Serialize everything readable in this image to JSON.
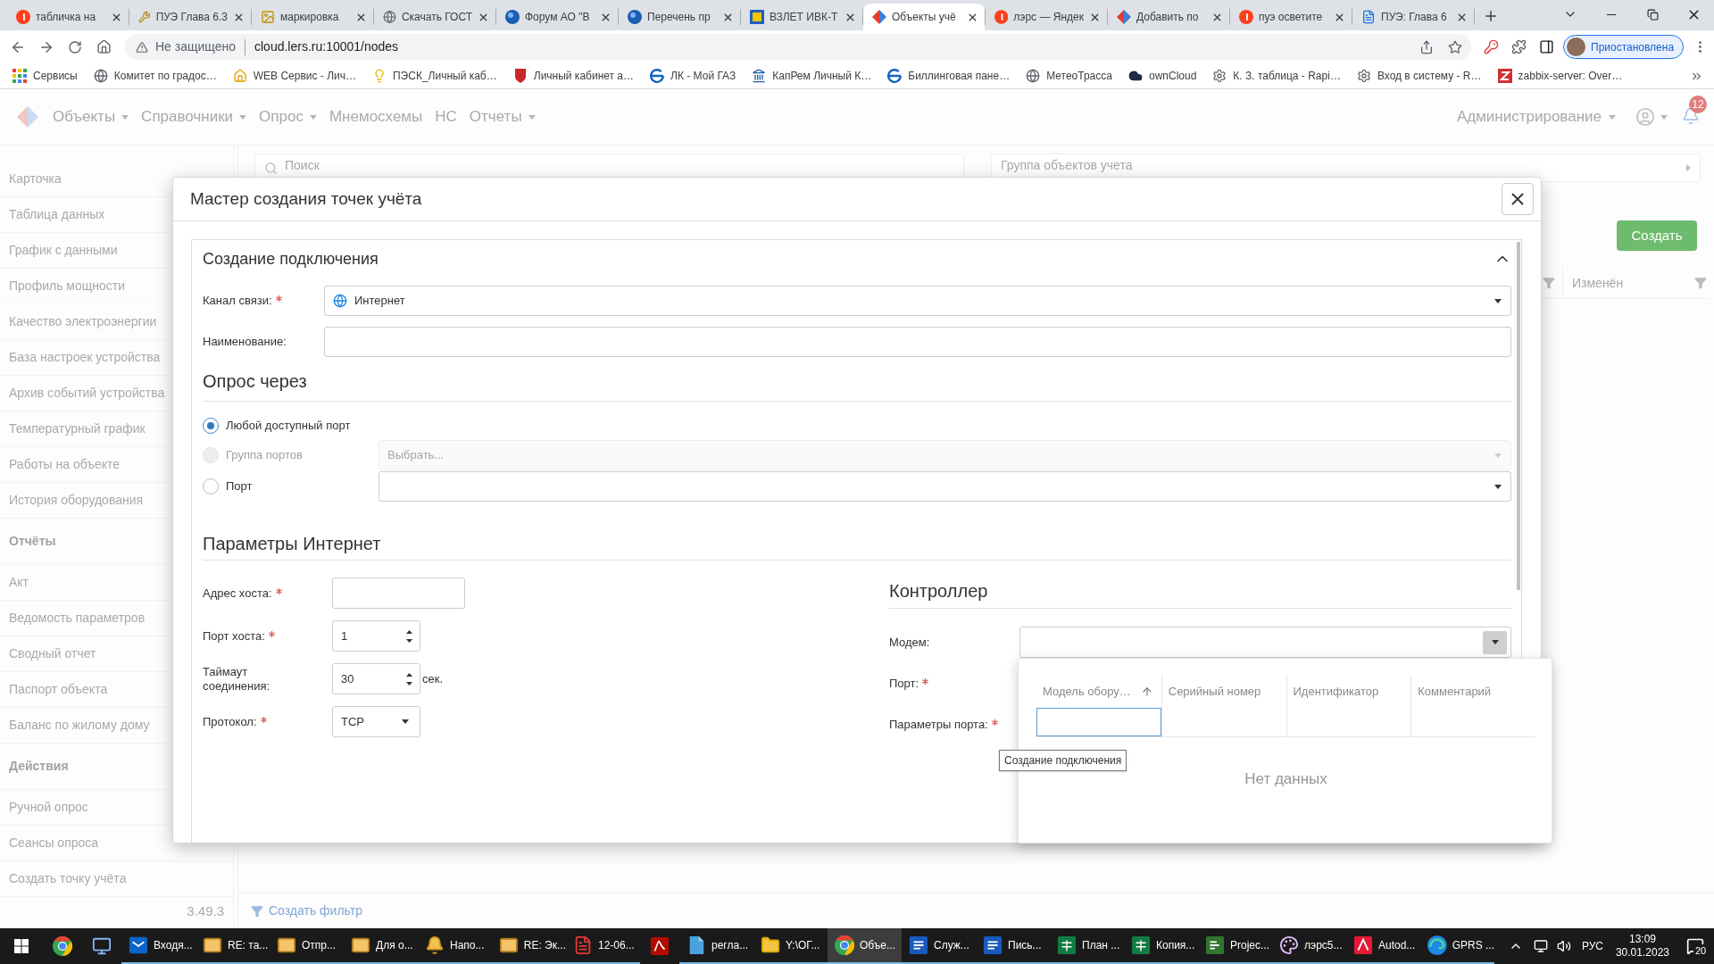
{
  "browser": {
    "tabs": [
      {
        "title": "табличка на",
        "kind": "badge",
        "selected": false
      },
      {
        "title": "ПУЭ Глава 6.3",
        "kind": "tools",
        "selected": false
      },
      {
        "title": "маркировка",
        "kind": "picture",
        "selected": false
      },
      {
        "title": "Скачать ГОСТ",
        "kind": "globe",
        "selected": false
      },
      {
        "title": "Форум АО \"В",
        "kind": "orb",
        "selected": false
      },
      {
        "title": "Перечень пр",
        "kind": "orb",
        "selected": false
      },
      {
        "title": "ВЗЛЕТ ИВК-Т",
        "kind": "tile",
        "selected": false
      },
      {
        "title": "Объекты учё",
        "kind": "diamond",
        "selected": true
      },
      {
        "title": "лэрс — Яндек",
        "kind": "badge",
        "selected": false
      },
      {
        "title": "Добавить по",
        "kind": "diamond",
        "selected": false
      },
      {
        "title": "пуэ осветите",
        "kind": "badge",
        "selected": false
      },
      {
        "title": "ПУЭ: Глава 6",
        "kind": "page",
        "selected": false
      }
    ],
    "security": "Не защищено",
    "url": "cloud.lers.ru:10001/nodes",
    "profile": "Приостановлена",
    "bookmarks": [
      {
        "label": "Сервисы",
        "kind": "grid"
      },
      {
        "label": "Комитет по градос…",
        "kind": "globe"
      },
      {
        "label": "WEB Сервис - Лич…",
        "kind": "house"
      },
      {
        "label": "ПЭСК_Личный каб…",
        "kind": "bulb"
      },
      {
        "label": "Личный кабинет а…",
        "kind": "shield"
      },
      {
        "label": "ЛК - Мой ГАЗ",
        "kind": "arc"
      },
      {
        "label": "КапРем Личный К…",
        "kind": "building"
      },
      {
        "label": "Биллинговая пане…",
        "kind": "arc"
      },
      {
        "label": "МетеоТрасса",
        "kind": "globe"
      },
      {
        "label": "ownCloud",
        "kind": "cloud"
      },
      {
        "label": "К. З. таблица - Rapi…",
        "kind": "gear"
      },
      {
        "label": "Вход в систему - R…",
        "kind": "gear"
      },
      {
        "label": "zabbix-server: Over…",
        "kind": "square"
      }
    ]
  },
  "app": {
    "nav": [
      {
        "label": "Объекты",
        "dropdown": true
      },
      {
        "label": "Справочники",
        "dropdown": true
      },
      {
        "label": "Опрос",
        "dropdown": true
      },
      {
        "label": "Мнемосхемы",
        "dropdown": false
      },
      {
        "label": "НС",
        "dropdown": false
      },
      {
        "label": "Отчеты",
        "dropdown": true
      }
    ],
    "admin": "Администрирование",
    "notifications": "12"
  },
  "sidebar": {
    "items": [
      {
        "kind": "link",
        "label": "Карточка"
      },
      {
        "kind": "link",
        "label": "Таблица данных"
      },
      {
        "kind": "link",
        "label": "График с данными"
      },
      {
        "kind": "link",
        "label": "Профиль мощности"
      },
      {
        "kind": "link",
        "label": "Качество электроэнергии"
      },
      {
        "kind": "link",
        "label": "База настроек устройства"
      },
      {
        "kind": "link",
        "label": "Архив событий устройства"
      },
      {
        "kind": "link",
        "label": "Температурный график"
      },
      {
        "kind": "link",
        "label": "Работы на объекте"
      },
      {
        "kind": "link",
        "label": "История оборудования"
      },
      {
        "kind": "heading",
        "label": "Отчёты"
      },
      {
        "kind": "link",
        "label": "Акт"
      },
      {
        "kind": "link",
        "label": "Ведомость параметров"
      },
      {
        "kind": "link",
        "label": "Сводный отчет"
      },
      {
        "kind": "link",
        "label": "Паспорт объекта"
      },
      {
        "kind": "link",
        "label": "Баланс по жилому дому"
      },
      {
        "kind": "heading",
        "label": "Действия"
      },
      {
        "kind": "link",
        "label": "Ручной опрос"
      },
      {
        "kind": "link",
        "label": "Сеансы опроса"
      },
      {
        "kind": "link",
        "label": "Создать точку учёта"
      }
    ],
    "version": "3.49.3"
  },
  "main": {
    "search_placeholder": "Поиск",
    "group_placeholder": "Группа объектов учета",
    "create": "Создать",
    "column": "Изменён",
    "filter_link": "Создать фильтр"
  },
  "dialog": {
    "title": "Мастер создания точек учёта",
    "connection": {
      "title": "Создание подключения",
      "expanded": true,
      "channel": {
        "label": "Канал связи:",
        "required": true,
        "value": "Интернет"
      },
      "name": {
        "label": "Наименование:",
        "required": false
      }
    },
    "poll": {
      "title": "Опрос через",
      "options": [
        {
          "kind": "plain",
          "label": "Любой доступный порт",
          "selected": true,
          "disabled": false
        },
        {
          "kind": "select",
          "label": "Группа портов",
          "selected": false,
          "disabled": true,
          "placeholder": "Выбрать..."
        },
        {
          "kind": "select",
          "label": "Порт",
          "selected": false,
          "disabled": false
        }
      ]
    },
    "internet": {
      "title": "Параметры Интернет",
      "fields": [
        {
          "kind": "text",
          "label": "Адрес хоста:",
          "required": true
        },
        {
          "kind": "number",
          "label": "Порт хоста:",
          "required": true,
          "value": "1"
        },
        {
          "kind": "number",
          "label": "Таймаут соединения:",
          "required": false,
          "value": "30",
          "unit": "сек."
        },
        {
          "kind": "select",
          "label": "Протокол:",
          "required": true,
          "value": "TCP"
        }
      ]
    },
    "controller": {
      "title": "Контроллер",
      "fields": [
        {
          "label": "Модем:",
          "required": false
        },
        {
          "label": "Порт:",
          "required": true
        },
        {
          "label": "Параметры порта:",
          "required": true
        }
      ]
    },
    "modem_list": {
      "open": true,
      "columns": [
        {
          "label": "Модель обору…",
          "sorted": true,
          "focused": true
        },
        {
          "label": "Серийный номер",
          "sorted": false,
          "focused": false
        },
        {
          "label": "Идентификатор",
          "sorted": false,
          "focused": false
        },
        {
          "label": "Комментарий",
          "sorted": false,
          "focused": false
        }
      ],
      "empty": "Нет данных"
    },
    "tooltip": "Создание подключения"
  },
  "taskbar": {
    "items": [
      {
        "kind": "browser",
        "selected": false
      },
      {
        "kind": "monitor",
        "selected": false
      },
      {
        "kind": "outlook",
        "label": "Входя...",
        "selected": false
      },
      {
        "kind": "mail",
        "label": "RE: та...",
        "selected": false
      },
      {
        "kind": "mail",
        "label": "Отпр...",
        "selected": false
      },
      {
        "kind": "mail",
        "label": "Для о...",
        "selected": false
      },
      {
        "kind": "bell",
        "label": "Напо...",
        "selected": false
      },
      {
        "kind": "mail",
        "label": "RE: Эк...",
        "selected": false
      },
      {
        "kind": "pdf",
        "label": "12-06...",
        "selected": false
      },
      {
        "kind": "acrobat",
        "selected": false
      },
      {
        "kind": "doc3d",
        "label": "регла...",
        "selected": false
      },
      {
        "kind": "folder",
        "label": "Y:\\ОГ...",
        "selected": false
      },
      {
        "kind": "browser",
        "label": "Объе...",
        "selected": true
      },
      {
        "kind": "word",
        "label": "Служ...",
        "selected": false
      },
      {
        "kind": "word",
        "label": "Пись...",
        "selected": false
      },
      {
        "kind": "excel",
        "label": "План ...",
        "selected": false
      },
      {
        "kind": "excel",
        "label": "Копия...",
        "selected": false
      },
      {
        "kind": "project",
        "label": "Projec...",
        "selected": false
      },
      {
        "kind": "palette",
        "label": "лэрс5...",
        "selected": false
      },
      {
        "kind": "autocad",
        "label": "Autod...",
        "selected": false
      },
      {
        "kind": "edge",
        "label": "GPRS ...",
        "selected": false
      }
    ],
    "language": "РУС",
    "time": "13:09",
    "date": "30.01.2023",
    "notifications": "20"
  }
}
